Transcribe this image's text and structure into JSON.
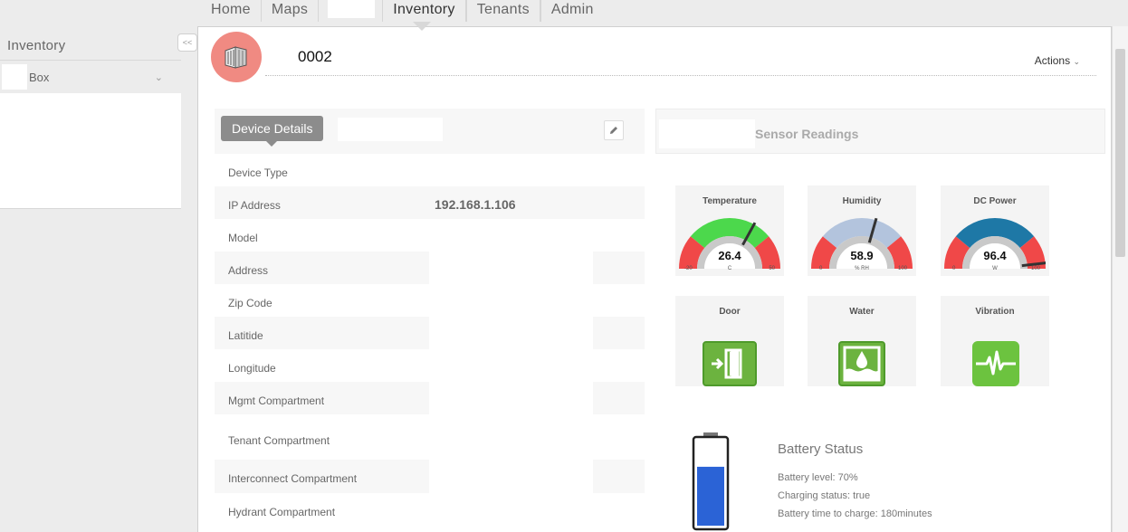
{
  "nav": {
    "items": [
      "Home",
      "Maps",
      "Inventory",
      "Tenants",
      "Admin"
    ],
    "active": "Inventory"
  },
  "sidebar": {
    "title": "Inventory",
    "select_value": "Box",
    "collapse_label": "<<"
  },
  "device": {
    "name": "0002",
    "actions_label": "Actions"
  },
  "details": {
    "tab_label": "Device Details",
    "rows": [
      {
        "label": "Device Type",
        "value": ""
      },
      {
        "label": "IP Address",
        "value": "192.168.1.106"
      },
      {
        "label": "Model",
        "value": ""
      },
      {
        "label": "Address",
        "value": ""
      },
      {
        "label": "Zip Code",
        "value": ""
      },
      {
        "label": "Latitide",
        "value": ""
      },
      {
        "label": "Longitude",
        "value": ""
      },
      {
        "label": "Mgmt Compartment",
        "value": ""
      },
      {
        "label": "Tenant Compartment",
        "value": ""
      },
      {
        "label": "Interconnect Compartment",
        "value": ""
      },
      {
        "label": "Hydrant Compartment",
        "value": ""
      }
    ]
  },
  "sensors": {
    "title": "Sensor Readings",
    "gauges": [
      {
        "title": "Temperature",
        "value": "26.4",
        "unit": "C",
        "min": "-20",
        "max": "50",
        "fraction": 0.66,
        "color": "#4cd84c"
      },
      {
        "title": "Humidity",
        "value": "58.9",
        "unit": "% RH",
        "min": "0",
        "max": "100",
        "fraction": 0.589,
        "color": "#b3c4dd"
      },
      {
        "title": "DC Power",
        "value": "96.4",
        "unit": "W",
        "min": "0",
        "max": "100",
        "fraction": 0.964,
        "color": "#1e78a6"
      }
    ],
    "indicators": [
      {
        "title": "Door",
        "icon": "door-exit-icon",
        "color": "#6cb33f"
      },
      {
        "title": "Water",
        "icon": "water-level-icon",
        "color": "#6cb33f"
      },
      {
        "title": "Vibration",
        "icon": "vibration-icon",
        "color": "#6cc33f"
      }
    ]
  },
  "battery": {
    "title": "Battery Status",
    "level_text": "Battery level: 70%",
    "charging_text": "Charging status: true",
    "time_text": "Battery time to charge: 180minutes",
    "level_fraction": 0.7,
    "fill_color": "#2b63d6"
  }
}
